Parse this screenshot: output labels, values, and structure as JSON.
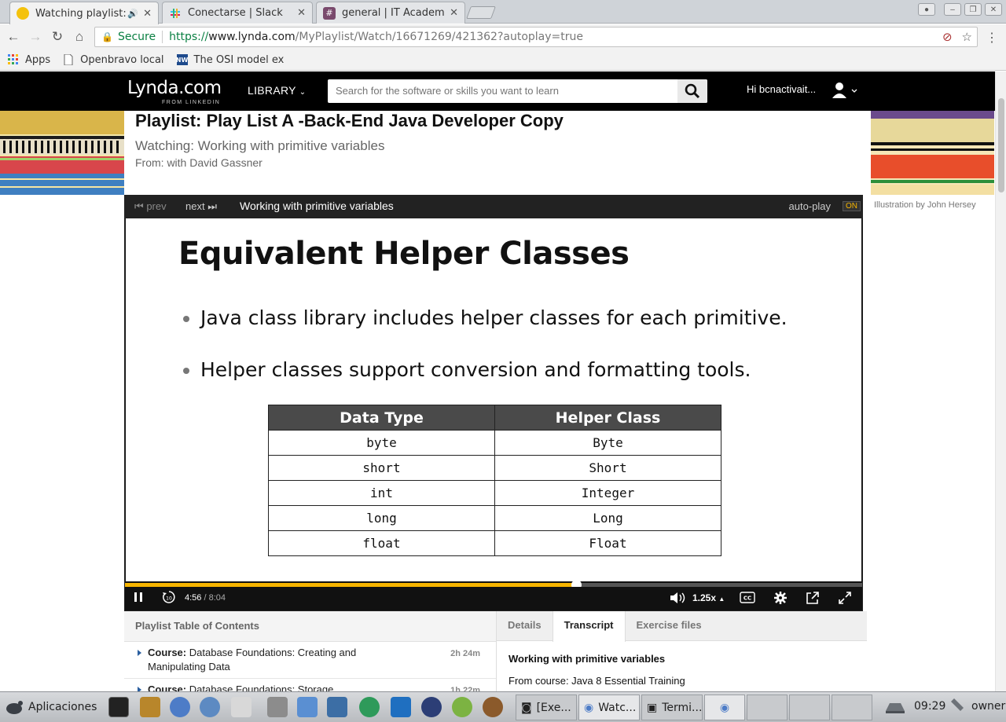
{
  "browser": {
    "tabs": [
      {
        "title": "Watching playlist:",
        "active": true
      },
      {
        "title": "Conectarse | Slack",
        "active": false
      },
      {
        "title": "general | IT Academ",
        "active": false
      }
    ],
    "secure_label": "Secure",
    "url_scheme": "https://",
    "url_host": "www.lynda.com",
    "url_path": "/MyPlaylist/Watch/16671269/421362?autoplay=true",
    "bookmarks": [
      "Apps",
      "Openbravo local",
      "The OSI model ex"
    ]
  },
  "header": {
    "logo": "Lynda.com",
    "logo_sub": "FROM LINKEDIN",
    "library": "LIBRARY",
    "search_placeholder": "Search for the software or skills you want to learn",
    "greeting": "Hi bcnactivait..."
  },
  "page": {
    "playlist_title": "Playlist: Play List A -Back-End Java Developer Copy",
    "watching": "Watching: Working with primitive variables",
    "from": "From: with David Gassner",
    "banner_credit": "Illustration by John Hersey"
  },
  "player": {
    "prev": "prev",
    "next": "next",
    "video_title": "Working with primitive variables",
    "autoplay": "auto-play",
    "autoplay_state": "ON",
    "current_time": "4:56",
    "duration": "8:04",
    "speed": "1.25x",
    "progress_fraction": 0.612
  },
  "slide": {
    "title": "Equivalent Helper Classes",
    "bullets": [
      "Java class library includes helper classes for each primitive.",
      "Helper classes support conversion and formatting tools."
    ],
    "table": {
      "headers": [
        "Data Type",
        "Helper Class"
      ],
      "rows": [
        [
          "byte",
          "Byte"
        ],
        [
          "short",
          "Short"
        ],
        [
          "int",
          "Integer"
        ],
        [
          "long",
          "Long"
        ],
        [
          "float",
          "Float"
        ]
      ]
    }
  },
  "toc": {
    "header": "Playlist Table of Contents",
    "items": [
      {
        "kind": "Course:",
        "title": "Database Foundations: Creating and Manipulating Data",
        "duration": "2h 24m"
      },
      {
        "kind": "Course:",
        "title": "Database Foundations: Storage",
        "duration": "1h 22m"
      }
    ]
  },
  "details_panel": {
    "tabs": [
      "Details",
      "Transcript",
      "Exercise files"
    ],
    "active_tab": "Transcript",
    "title": "Working with primitive variables",
    "from_course": "From course: Java 8 Essential Training"
  },
  "taskbar": {
    "apps_label": "Aplicaciones",
    "windows": [
      "[Exe...",
      "Watc...",
      "Termi..."
    ],
    "clock": "09:29",
    "user": "owner"
  },
  "colors": {
    "progress": "#f7b500",
    "header_bg": "#000000",
    "secure_green": "#0b8043"
  }
}
